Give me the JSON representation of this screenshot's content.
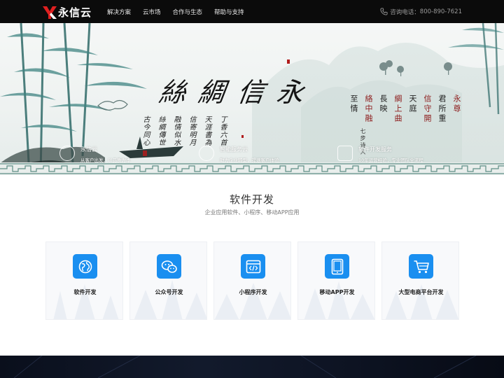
{
  "header": {
    "logo_text": "永信云",
    "nav": [
      "解决方案",
      "云市场",
      "合作与生态",
      "帮助与支持"
    ],
    "hotline_label": "咨询电话：",
    "hotline_number": "800-890-7621"
  },
  "hero": {
    "calligraphy": [
      "絲",
      "綢",
      "信",
      "永"
    ],
    "script_lines": [
      "丁香六首",
      "天涯書為",
      "信寄明月",
      "融情似水",
      "絲綢傳世",
      "古今同心"
    ],
    "verse": [
      "永尊",
      "信守開",
      "綢上曲",
      "絡中融",
      "君所重",
      "天庭",
      "長映",
      "至情"
    ],
    "verse_author": "七步诗人",
    "features": [
      {
        "title": "永信云",
        "sub": "从客户出发，以品质为本"
      },
      {
        "title": "智能服务云",
        "sub": "助力企业转型，提速客户体验"
      },
      {
        "title": "软件开发服务",
        "sub": "10年运营经验，专业团队全流程"
      }
    ]
  },
  "section": {
    "title": "软件开发",
    "subtitle": "企业应用软件、小程序、移动APP应用"
  },
  "cards": [
    {
      "label": "软件开发",
      "icon": "globe-icon"
    },
    {
      "label": "公众号开发",
      "icon": "wechat-icon"
    },
    {
      "label": "小程序开发",
      "icon": "code-window-icon"
    },
    {
      "label": "移动APP开发",
      "icon": "tablet-icon"
    },
    {
      "label": "大型电商平台开发",
      "icon": "cart-icon"
    }
  ],
  "colors": {
    "header_bg": "#0b0b0b",
    "accent_blue": "#1a8ff0",
    "logo_red": "#e02020"
  }
}
